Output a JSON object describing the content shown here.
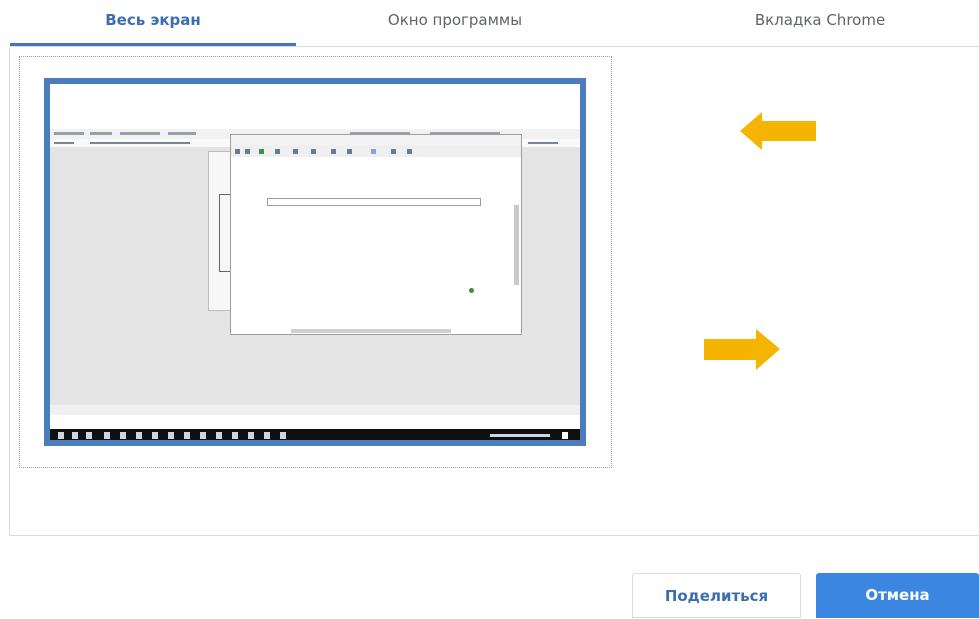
{
  "tabs": [
    {
      "label": "Весь экран",
      "active": true
    },
    {
      "label": "Окно программы",
      "active": false
    },
    {
      "label": "Вкладка Chrome",
      "active": false
    }
  ],
  "colors": {
    "accent": "#3f78c0",
    "arrow": "#f5b400",
    "primary_button": "#3a86e0"
  },
  "preview": {
    "icon": "screen-thumbnail"
  },
  "buttons": {
    "share_label": "Поделиться",
    "cancel_label": "Отмена"
  }
}
